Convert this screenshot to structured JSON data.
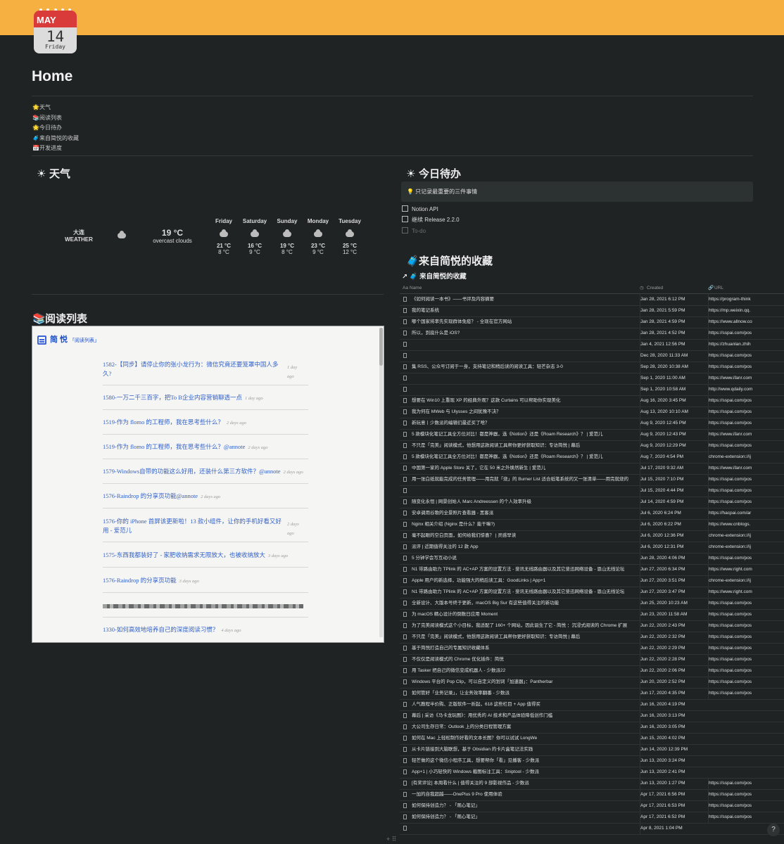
{
  "calendar": {
    "month": "MAY",
    "date": "14",
    "weekday": "Friday"
  },
  "page_title": "Home",
  "toc": [
    "🌟天气",
    "📚阅读列表",
    "🌟今日待办",
    "🧳来自简悦的收藏",
    "📅开发进度"
  ],
  "weather_section": {
    "heading": "天气",
    "city": "大连",
    "label": "WEATHER",
    "temp": "19 °C",
    "desc": "overcast clouds",
    "forecast": [
      {
        "day": "Friday",
        "hi": "21 °C",
        "lo": "8 °C"
      },
      {
        "day": "Saturday",
        "hi": "16 °C",
        "lo": "9 °C"
      },
      {
        "day": "Sunday",
        "hi": "19 °C",
        "lo": "8 °C"
      },
      {
        "day": "Monday",
        "hi": "23 °C",
        "lo": "9 °C"
      },
      {
        "day": "Tuesday",
        "hi": "25 °C",
        "lo": "12 °C"
      }
    ]
  },
  "reading_section": {
    "heading": "阅读列表",
    "brand": "简 悦",
    "brand_sub": "「阅读列表」",
    "items": [
      {
        "title": "1582-【同步】请停止你的张小龙行为：微信究竟还要笼罩中国人多久?",
        "ago": "1 day ago"
      },
      {
        "title": "1580-一万二千三百字，把To B企业内容营销聊透一点",
        "ago": "1 day ago"
      },
      {
        "title": "1519-作为 flomo 的工程师，我在思考些什么？",
        "ago": "2 days ago"
      },
      {
        "title": "1519-作为 flomo 的工程师，我在思考些什么？@annote",
        "ago": "2 days ago"
      },
      {
        "title": "1579-Windows自带的功能这么好用，还装什么第三方软件？@annote",
        "ago": "2 days ago"
      },
      {
        "title": "1576-Raindrop 的分享页功能@annote",
        "ago": "2 days ago"
      },
      {
        "title": "1576-你的 iPhone 首屏该更新啦！13 款小组件，让你的手机好看又好用 - 爱范儿",
        "ago": "2 days ago"
      },
      {
        "title": "1575-东西我都装好了 - 家肥收纳需求无限放大，也被收纳放大",
        "ago": "3 days ago"
      },
      {
        "title": "1576-Raindrop 的分享页功能",
        "ago": "3 days ago"
      },
      {
        "title": "",
        "ago": ""
      },
      {
        "title": "1330-如何高效地培养自己的深度阅读习惯？",
        "ago": "4 days ago"
      }
    ]
  },
  "todo_section": {
    "heading": "今日待办",
    "callout": "💡 只记录最重要的三件事情",
    "items": [
      {
        "label": "Notion API",
        "done": false
      },
      {
        "label": "继续 Release 2.2.0",
        "done": false
      },
      {
        "label": "To-do",
        "placeholder": true
      }
    ]
  },
  "collection_section": {
    "heading": "来自简悦的收藏",
    "db_title": "来自简悦的收藏",
    "columns": {
      "name": "Name",
      "created": "Created",
      "url": "URL"
    },
    "rows": [
      {
        "name": "《如何阅读一本书》——书评及内容摘要",
        "created": "Jan 28, 2021 6:12 PM",
        "url": "https://program-think"
      },
      {
        "name": "我的笔记系统",
        "created": "Jan 28, 2021 5:59 PM",
        "url": "https://mp.weixin.qq."
      },
      {
        "name": "哪个国家将率先实现群体免疫？ - 全现在官方网站",
        "created": "Jan 28, 2021 4:59 PM",
        "url": "https://www.allnow.co"
      },
      {
        "name": "所以，到底什么是 iOS?",
        "created": "Jan 28, 2021 4:52 PM",
        "url": "https://sspai.com/pos"
      },
      {
        "name": "",
        "created": "Jan 4, 2021 12:56 PM",
        "url": "https://zhuanlan.zhih"
      },
      {
        "name": "",
        "created": "Dec 28, 2020 11:33 AM",
        "url": "https://sspai.com/pos"
      },
      {
        "name": "集 RSS、公众号订阅于一身，支持笔记和稍后读的阅读工具：轻芒杂志 3-0",
        "created": "Sep 28, 2020 10:38 AM",
        "url": "https://sspai.com/pos"
      },
      {
        "name": "",
        "created": "Sep 1, 2020 11:00 AM",
        "url": "https://www.ifanr.com"
      },
      {
        "name": "",
        "created": "Sep 1, 2020 10:58 AM",
        "url": "http://www.qdaily.com"
      },
      {
        "name": "想要在 Win10 上重现 XP 的经典外观？这款 Curtains 可以帮助你实现美化",
        "created": "Aug 16, 2020 3:45 PM",
        "url": "https://sspai.com/pos"
      },
      {
        "name": "我为何在 MWeb 与 Ulysses 之间犹豫不决？",
        "created": "Aug 13, 2020 10:10 AM",
        "url": "https://sspai.com/pos"
      },
      {
        "name": "新玩意丨少数派的编辑们最近买了啥？",
        "created": "Aug 9, 2020 12:45 PM",
        "url": "https://sspai.com/pos"
      },
      {
        "name": "5 款模块化笔记工具全方位对比！都是神器，选《Notion》还是《Roam Research》？ | 爱范儿",
        "created": "Aug 9, 2020 12:43 PM",
        "url": "https://www.ifanr.com"
      },
      {
        "name": "不只是「完美」阅读模式，他想用这款阅读工具帮你更好获取知识：专访简悦 | 幕后",
        "created": "Aug 9, 2020 12:29 PM",
        "url": "https://sspai.com/pos"
      },
      {
        "name": "5 款模块化笔记工具全方位对比！都是神器，选《Notion》还是《Roam Research》？ | 爱范儿",
        "created": "Aug 7, 2020 4:54 PM",
        "url": "chrome-extension://ij"
      },
      {
        "name": "中国第一家的 Apple Store 关了，它在 50 米之外焕然新生 | 爱范儿",
        "created": "Jul 17, 2020 9:32 AM",
        "url": "https://www.ifanr.com"
      },
      {
        "name": "用一张白纸就能完成的任务管理——用完就「烧」的 Burner List 适合纸笔系统的又一张清单——用完就烧的",
        "created": "Jul 15, 2020 7:10 PM",
        "url": "https://sspai.com/pos"
      },
      {
        "name": "",
        "created": "Jul 15, 2020 4:44 PM",
        "url": "https://sspai.com/pos"
      },
      {
        "name": "随变化永恒 | 网景创始人 Marc Andreessen 的个人效率升级",
        "created": "Jul 14, 2020 4:59 PM",
        "url": "https://sspai.com/pos"
      },
      {
        "name": "安卓调用谷歌的全景照片查看器 - 黑客派",
        "created": "Jul 6, 2020 6:24 PM",
        "url": "https://hacpai.com/ar"
      },
      {
        "name": "Nginx 相关介绍 (Nginx 是什么？能干嘛?)",
        "created": "Jul 6, 2020 6:22 PM",
        "url": "https://www.cnblogs."
      },
      {
        "name": "毫不起眼的空白页面，如何给我们惊喜？ | 灵感早读",
        "created": "Jul 6, 2020 12:36 PM",
        "url": "chrome-extension://ij"
      },
      {
        "name": "派评 | 近期值得关注的 12 款 App",
        "created": "Jul 6, 2020 12:31 PM",
        "url": "chrome-extension://ij"
      },
      {
        "name": "5 分钟学会写互动小说",
        "created": "Jun 28, 2020 4:06 PM",
        "url": "https://sspai.com/pos"
      },
      {
        "name": "N1 带路由助力 TPlink 的 AC+AP 方案的设置方法 - 斐讯无线路由器以及其它斐迅网络设备 - 恩山无线论坛",
        "created": "Jun 27, 2020 6:34 PM",
        "url": "https://www.right.com"
      },
      {
        "name": "Apple 用户的新选择，功能强大的稍后读工具：GoodLinks | App+1",
        "created": "Jun 27, 2020 3:51 PM",
        "url": "chrome-extension://ij"
      },
      {
        "name": "N1 带路由助力 TPlink 的 AC+AP 方案的设置方法 - 斐讯无线路由器以及其它斐迅网络设备 - 恩山无线论坛",
        "created": "Jun 27, 2020 3:47 PM",
        "url": "https://www.right.com"
      },
      {
        "name": "全新设计、大版本号终于更新，macOS Big Sur 有这些值得关注的新功能",
        "created": "Jun 25, 2020 10:23 AM",
        "url": "https://sspai.com/pos"
      },
      {
        "name": "为 macOS 精心设计的倒数日应用 Moment",
        "created": "Jun 23, 2020 11:58 AM",
        "url": "https://sspai.com/pos"
      },
      {
        "name": "为了完美阅读模式这个小目标，我适配了 160+ 个网站，因此诞生了它 - 简悦 ：沉浸式阅读的 Chrome 扩展",
        "created": "Jun 22, 2020 2:43 PM",
        "url": "https://sspai.com/pos"
      },
      {
        "name": "不只是「完美」阅读模式，他想用这款阅读工具帮你更好获取知识：专访简悦 | 幕后",
        "created": "Jun 22, 2020 2:32 PM",
        "url": "https://sspai.com/pos"
      },
      {
        "name": "基于简悦打造自己的专属知识收藏体系",
        "created": "Jun 22, 2020 2:29 PM",
        "url": "https://sspai.com/pos"
      },
      {
        "name": "不仅仅是阅读模式的 Chrome 优化插件：简悦",
        "created": "Jun 22, 2020 2:28 PM",
        "url": "https://sspai.com/pos"
      },
      {
        "name": "用 Tasker 把自己的微信变成机器人 - 少数派22",
        "created": "Jun 22, 2020 2:06 PM",
        "url": "https://sspai.com/pos"
      },
      {
        "name": "Windows 平台的 Pop Clip，可以自定义的划词「加速器」：Pantherbar",
        "created": "Jun 20, 2020 2:52 PM",
        "url": "https://sspai.com/pos"
      },
      {
        "name": "如何管好「业务记录」，让业务效率翻番 - 少数派",
        "created": "Jun 17, 2020 4:35 PM",
        "url": "https://sspai.com/pos"
      },
      {
        "name": "人气教程半价购、正版软件一折起，618 这些栏目 + App 值得买",
        "created": "Jun 16, 2020 4:19 PM",
        "url": ""
      },
      {
        "name": "幕后 | 采访《马卡龙玩图》：用优秀的 AI 技术和产品体验降低创作门槛",
        "created": "Jun 16, 2020 3:13 PM",
        "url": ""
      },
      {
        "name": "大公司生存日常：Outlook 上的分类日程管理方案",
        "created": "Jun 16, 2020 3:05 PM",
        "url": ""
      },
      {
        "name": "如何在 Mac 上轻松制作好看的文本长图？你可以试试 LongWe",
        "created": "Jun 15, 2020 4:02 PM",
        "url": ""
      },
      {
        "name": "从卡片链接到大脑联想，基于 Obsidian 的卡片盒笔记法实践",
        "created": "Jun 14, 2020 12:39 PM",
        "url": ""
      },
      {
        "name": "轻芒做的这个微信小程序工具，想要帮你「看」见播客 - 少数派",
        "created": "Jun 13, 2020 3:24 PM",
        "url": ""
      },
      {
        "name": "App+1 | 小巧轻快的 Windows 截图标注工具：Sniptool - 少数派",
        "created": "Jun 13, 2020 2:41 PM",
        "url": ""
      },
      {
        "name": "[有奖评论] 本周看什么 | 值得关注的 9 部影视作品 - 少数派",
        "created": "Jun 13, 2020 1:27 PM",
        "url": "https://sspai.com/pos"
      },
      {
        "name": "一加的自我超越——OnePlus 9 Pro 使用体验",
        "created": "Apr 17, 2021 6:56 PM",
        "url": "https://sspai.com/pos"
      },
      {
        "name": "如何保持创造力？ - 「观心笔记」",
        "created": "Apr 17, 2021 6:53 PM",
        "url": "https://sspai.com/pos"
      },
      {
        "name": "如何保持创造力？ - 「观心笔记」",
        "created": "Apr 17, 2021 6:52 PM",
        "url": "https://sspai.com/pos"
      },
      {
        "name": "",
        "created": "Apr 8, 2021 1:04 PM",
        "url": ""
      }
    ]
  },
  "help_button": "?",
  "add_button": "+ ⠿",
  "colors": {
    "banner": "#f5b041",
    "background": "#1f2324",
    "link": "#3060c8"
  }
}
